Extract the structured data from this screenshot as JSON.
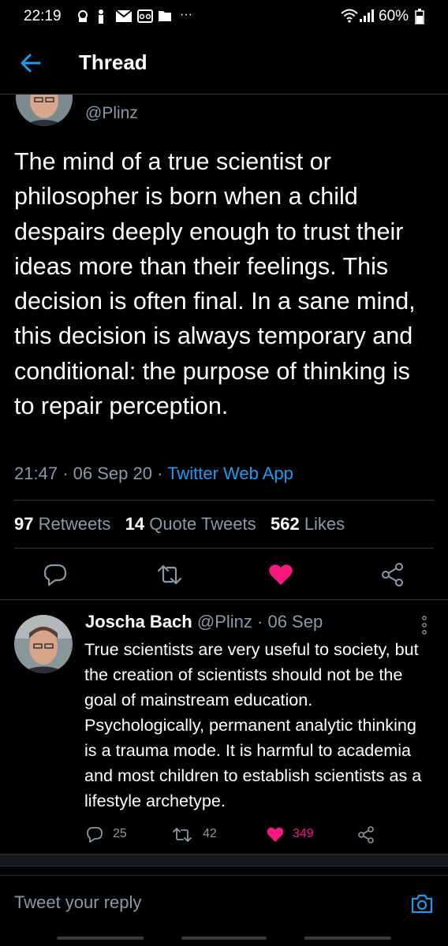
{
  "status_bar": {
    "time": "22:19",
    "more_indicator": "···",
    "battery": "60%"
  },
  "header": {
    "title": "Thread"
  },
  "main_tweet": {
    "handle": "@Plinz",
    "text": "The mind of a true scientist or philosopher is born when a child despairs deeply enough to trust their ideas more than their feelings. This decision is often final. In a sane mind, this decision is always temporary and conditional: the purpose of thinking is to repair perception.",
    "time": "21:47",
    "date": "06 Sep 20",
    "separator": "·",
    "source": "Twitter Web App",
    "stats": {
      "retweets_count": "97",
      "retweets_label": "Retweets",
      "quotes_count": "14",
      "quotes_label": "Quote Tweets",
      "likes_count": "562",
      "likes_label": "Likes"
    }
  },
  "reply_tweet": {
    "name": "Joscha Bach",
    "handle": "@Plinz",
    "separator": "·",
    "date": "06 Sep",
    "text": "True scientists are very useful to society, but the creation of scientists should not be the goal of mainstream education. Psychologically, permanent analytic thinking is a trauma mode. It is harmful to academia and most children to establish scientists as a lifestyle archetype.",
    "replies": "25",
    "retweets": "42",
    "likes": "349"
  },
  "reply_bar": {
    "placeholder": "Tweet your reply"
  },
  "colors": {
    "background": "#000000",
    "accent": "#1d9bf0",
    "like": "#f91880",
    "secondary_text": "#8b98a5",
    "divider": "#2f3336"
  }
}
